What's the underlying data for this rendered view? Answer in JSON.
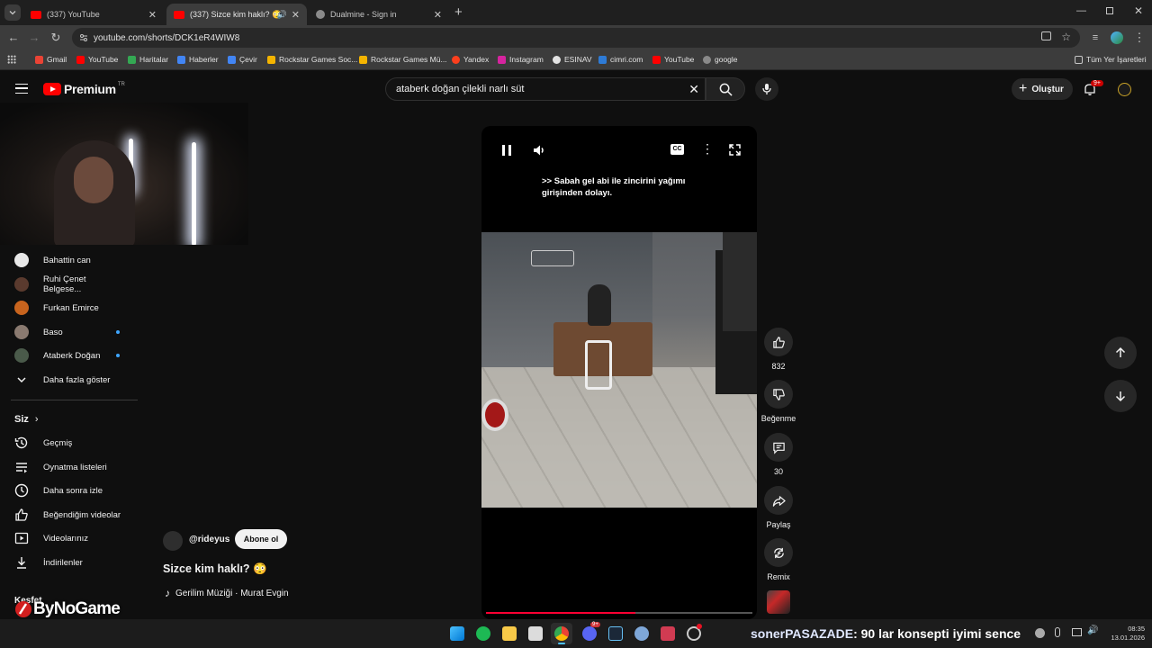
{
  "browser": {
    "tabs": [
      {
        "title": "(337) YouTube",
        "active": false
      },
      {
        "title": "(337) Sizce kim haklı? 😳 -",
        "active": true
      },
      {
        "title": "Dualmine - Sign in",
        "active": false
      }
    ],
    "url": "youtube.com/shorts/DCK1eR4WIW8",
    "bookmarks": [
      "Gmail",
      "YouTube",
      "Haritalar",
      "Haberler",
      "Çevir",
      "Rockstar Games Soc...",
      "Rockstar Games Mü...",
      "Yandex",
      "Instagram",
      "ESINAV",
      "cimri.com",
      "YouTube",
      "google"
    ],
    "all_bookmarks": "Tüm Yer İşaretleri"
  },
  "youtube": {
    "logo": "Premium",
    "logo_region": "TR",
    "search_value": "ataberk doğan çilekli narlı süt",
    "create_label": "Oluştur",
    "notif_badge": "9+",
    "subscriptions": [
      "Bahattin can",
      "Ruhi Çenet Belgese...",
      "Furkan Emirce",
      "Baso",
      "Ataberk Doğan"
    ],
    "show_more": "Daha fazla göster",
    "you_section": "Siz",
    "you_items": [
      "Geçmiş",
      "Oynatma listeleri",
      "Daha sonra izle",
      "Beğendiğim videolar",
      "Videolarınız",
      "İndirilenler"
    ],
    "explore_section": "Keşfet",
    "video": {
      "caption_line1": ">> Sabah gel abi ile zincirini yağımı",
      "caption_line2": "girişinden dolayı.",
      "cc_label": "CC",
      "channel": "@rideyus",
      "subscribe": "Abone ol",
      "title": "Sizce kim haklı? 😳",
      "music": "Gerilim Müziği · Murat Evgin",
      "likes": "832",
      "dislike_label": "Beğenme",
      "comments": "30",
      "share_label": "Paylaş",
      "remix_label": "Remix"
    }
  },
  "overlay": {
    "brand": "ByNoGame",
    "chat_user": "sonerPASAZADE",
    "chat_text": ": 90 lar konsepti iyimi sence"
  },
  "taskbar": {
    "time": "08:35",
    "date": "13.01.2026",
    "discord_badge": "9+"
  },
  "colors": {
    "youtube_red": "#ff0000",
    "page_bg": "#0f0f0f",
    "progress": "#ff0033"
  }
}
